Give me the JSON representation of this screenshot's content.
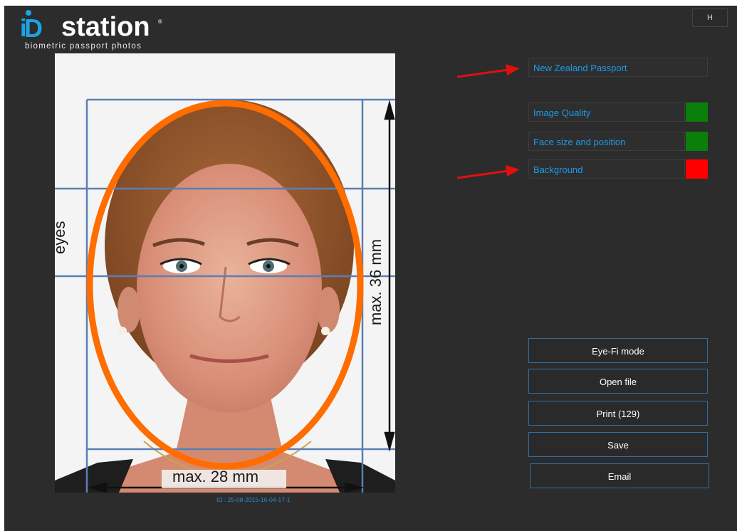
{
  "logo": {
    "letter_i": "i",
    "letter_d": "D",
    "wordmark": "station",
    "registered": "®",
    "tagline": "biometric passport photos"
  },
  "help_button": {
    "label": "H"
  },
  "passport_type": {
    "value": "New Zealand Passport"
  },
  "checks": [
    {
      "label": "Image Quality",
      "status": "pass",
      "color": "#0a7f0a"
    },
    {
      "label": "Face size and position",
      "status": "pass",
      "color": "#0a7f0a"
    },
    {
      "label": "Background",
      "status": "fail",
      "color": "#ff0000"
    }
  ],
  "photo": {
    "overlay": {
      "eyes_label": "eyes",
      "height_label": "max. 36 mm",
      "width_label": "max. 28 mm",
      "oval_color": "#ff6d00",
      "guide_color": "#5a7fb5"
    },
    "id_text": "ID : 25-08-2015-16-04-17-1"
  },
  "buttons": {
    "eyefi": "Eye-Fi mode",
    "open_file": "Open file",
    "print": "Print  (129)",
    "save": "Save",
    "email": "Email"
  },
  "annotation_arrow_color": "#e01010"
}
